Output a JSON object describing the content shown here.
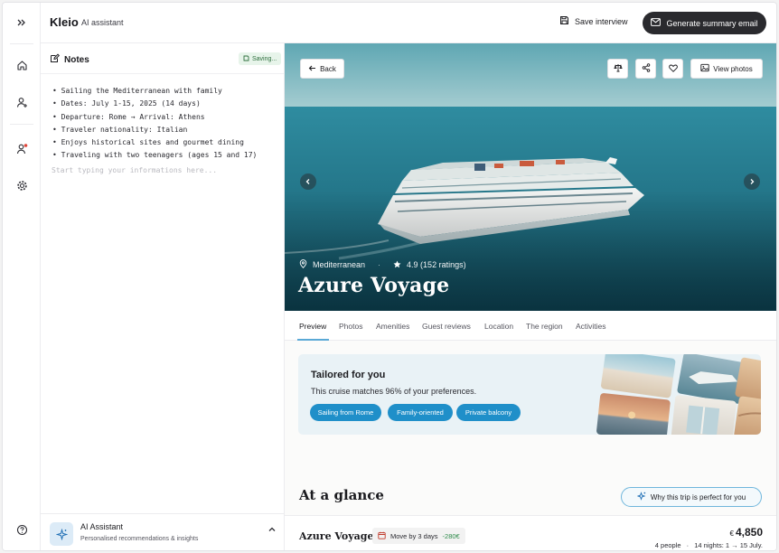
{
  "app": {
    "brand": "Kleio",
    "subtitle": "AI assistant"
  },
  "topbar": {
    "save_label": "Save interview",
    "generate_label": "Generate summary email"
  },
  "rail": {
    "icons": [
      "expand-icon",
      "home-icon",
      "add-user-icon",
      "user-alert-icon",
      "settings-icon",
      "help-icon"
    ]
  },
  "notes": {
    "title": "Notes",
    "status": "Saving...",
    "lines": [
      "• Sailing the Mediterranean with family",
      "• Dates: July 1-15, 2025 (14 days)",
      "• Departure: Rome → Arrival: Athens",
      "• Traveler nationality: Italian",
      "• Enjoys historical sites and gourmet dining",
      "• Traveling with two teenagers (ages 15 and 17)"
    ],
    "placeholder": "Start typing your informations here..."
  },
  "assistant": {
    "title": "AI Assistant",
    "subtitle": "Personalised recommendations & insights"
  },
  "hero": {
    "back_label": "Back",
    "view_photos_label": "View photos",
    "location": "Mediterranean",
    "rating": "4.9 (152 ratings)",
    "title": "Azure Voyage"
  },
  "tabs": [
    "Preview",
    "Photos",
    "Amenities",
    "Guest reviews",
    "Location",
    "The region",
    "Activities"
  ],
  "tailored": {
    "title": "Tailored for you",
    "subtitle": "This cruise matches 96% of your preferences.",
    "chips": [
      "Sailing from Rome",
      "Family-oriented",
      "Private balcony"
    ]
  },
  "glance": {
    "title": "At a glance",
    "why_label": "Why this trip is perfect for you"
  },
  "summary": {
    "title": "Azure Voyage",
    "move_label": "Move by 3 days",
    "move_saving": "-280€",
    "currency": "€",
    "price": "4,850",
    "people": "4 people",
    "separator": "·",
    "nights": "14 nights: 1 → 15 July."
  },
  "colors": {
    "accent": "#1f8fc9",
    "dark_button": "#2a2a2e",
    "sea": "#2f8ca0"
  }
}
